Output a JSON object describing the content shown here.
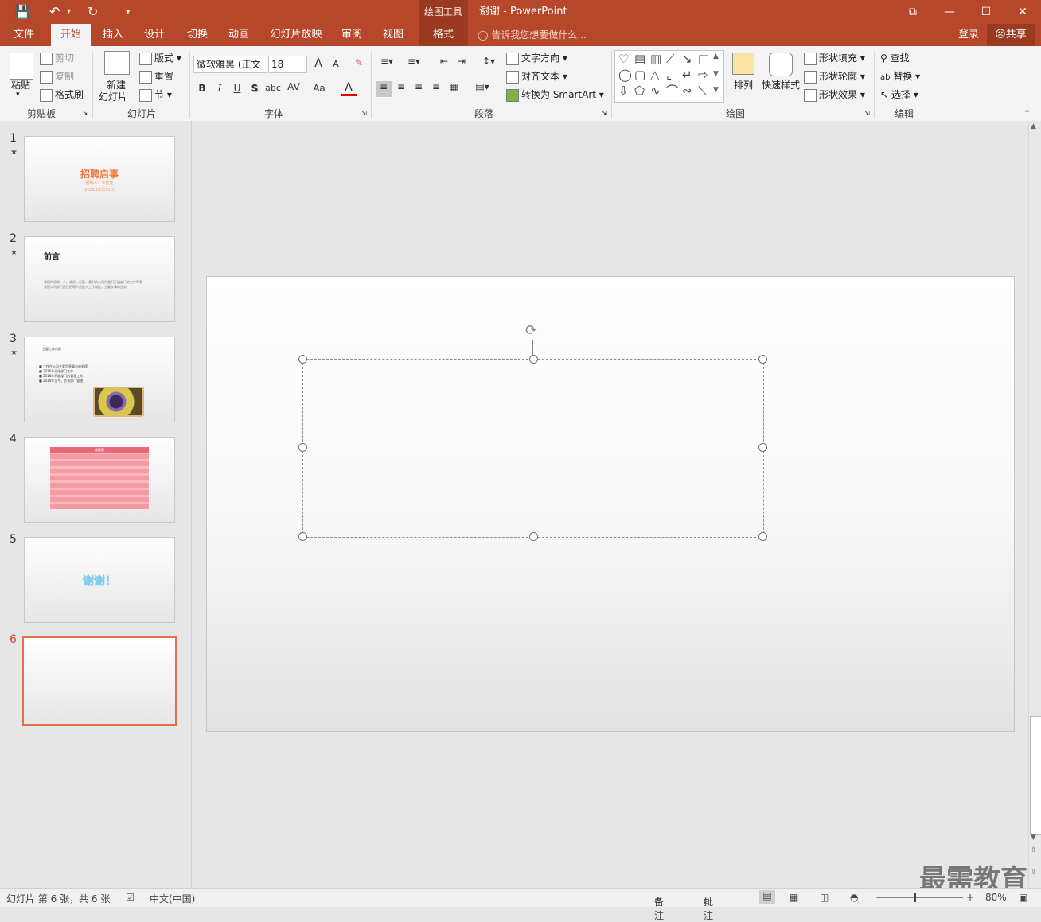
{
  "titlebar": {
    "context_tool": "绘图工具",
    "title": "谢谢 - PowerPoint",
    "save_icon": "save-icon",
    "undo_icon": "undo-icon",
    "redo_icon": "redo-icon",
    "customize_icon": "customize-qat-icon",
    "win_restore": "⧉",
    "win_min": "—",
    "win_max": "☐",
    "win_close": "✕"
  },
  "tabs": {
    "file": "文件",
    "home": "开始",
    "insert": "插入",
    "design": "设计",
    "transitions": "切换",
    "animations": "动画",
    "slideshow": "幻灯片放映",
    "review": "审阅",
    "view": "视图",
    "format": "格式",
    "tellme": "告诉我您想要做什么...",
    "login": "登录",
    "share": "共享"
  },
  "ribbon": {
    "clipboard": {
      "paste": "粘贴",
      "cut": "剪切",
      "copy": "复制",
      "format_painter": "格式刷",
      "label": "剪贴板"
    },
    "slides": {
      "new_slide_1": "新建",
      "new_slide_2": "幻灯片",
      "layout": "版式",
      "reset": "重置",
      "section": "节",
      "label": "幻灯片"
    },
    "font": {
      "font_name": "微软雅黑 (正文",
      "font_size": "18",
      "grow": "A",
      "shrink": "A",
      "bold": "B",
      "italic": "I",
      "underline": "U",
      "shadow": "S",
      "strike": "abc",
      "spacing": "AV",
      "case": "Aa",
      "color": "A",
      "label": "字体"
    },
    "paragraph": {
      "text_direction": "文字方向",
      "align_text": "对齐文本",
      "smartart": "转换为 SmartArt",
      "label": "段落"
    },
    "drawing": {
      "arrange": "排列",
      "quick_styles": "快速样式",
      "shape_fill": "形状填充",
      "shape_outline": "形状轮廓",
      "shape_effects": "形状效果",
      "label": "绘图"
    },
    "editing": {
      "find": "查找",
      "replace": "替换",
      "select": "选择",
      "label": "编辑"
    }
  },
  "thumbnails": [
    {
      "num": "1",
      "star": "★",
      "title": "招聘启事",
      "sub1": "招聘人：李佳佳",
      "sub2": "2021年1月15日"
    },
    {
      "num": "2",
      "star": "★",
      "title": "前言",
      "body1": "我们的周期、人、体质，但是，我们的公司为我们开展部门的工作等等",
      "body2": "我们公司部门正在招聘人员进入工作岗位，主要从事的业务"
    },
    {
      "num": "3",
      "star": "★",
      "title": "主要工作内容",
      "b1": "工作在公司主要负责事务的处理",
      "b2": "2016年开始部门工作",
      "b3": "2018年开展部门的管理工作",
      "b4": "2019年至今，负责部门管理"
    },
    {
      "num": "4",
      "table_title": "成绩表"
    },
    {
      "num": "5",
      "title": "谢谢！"
    },
    {
      "num": "6"
    }
  ],
  "status": {
    "slide_info": "幻灯片 第 6 张，共 6 张",
    "language": "中文(中国)",
    "notes": "备注",
    "comments": "批注",
    "zoom": "80%"
  },
  "watermark": "最需教育"
}
